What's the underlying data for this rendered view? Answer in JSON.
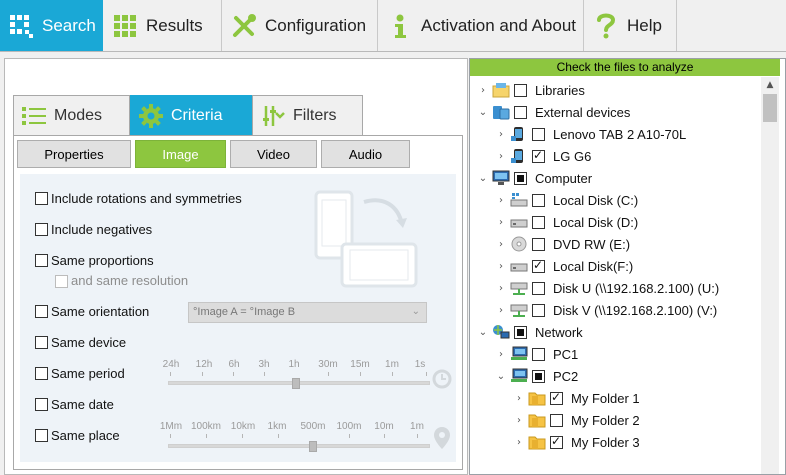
{
  "toolbar": {
    "tabs": [
      {
        "label": "Search",
        "icon": "magnifier-grid-icon",
        "active": true
      },
      {
        "label": "Results",
        "icon": "grid-icon",
        "active": false
      },
      {
        "label": "Configuration",
        "icon": "wrench-screwdriver-icon",
        "active": false
      },
      {
        "label": "Activation and About",
        "icon": "info-icon",
        "active": false
      },
      {
        "label": "Help",
        "icon": "question-icon",
        "active": false
      }
    ]
  },
  "left": {
    "subtabs": [
      {
        "label": "Modes",
        "icon": "list-icon"
      },
      {
        "label": "Criteria",
        "icon": "gear-icon"
      },
      {
        "label": "Filters",
        "icon": "filter-icon"
      }
    ],
    "buttons": [
      "Properties",
      "Image",
      "Video",
      "Audio"
    ],
    "options": {
      "rotations": "Include rotations and symmetries",
      "negatives": "Include negatives",
      "proportions": "Same proportions",
      "resolution": "and same resolution",
      "orientation": "Same orientation",
      "orientation_value": "°Image A  = °Image B",
      "device": "Same device",
      "period": "Same period",
      "date": "Same date",
      "place": "Same place"
    },
    "period_ticks": [
      "24h",
      "12h",
      "6h",
      "3h",
      "1h",
      "30m",
      "15m",
      "1m",
      "1s"
    ],
    "place_ticks": [
      "1Mm",
      "100km",
      "10km",
      "1km",
      "500m",
      "100m",
      "10m",
      "1m"
    ]
  },
  "tree": {
    "header": "Check the files to analyze",
    "rows": [
      {
        "label": "Libraries",
        "level": 0,
        "arrow": "›",
        "icon": "library-icon",
        "check": "none"
      },
      {
        "label": "External devices",
        "level": 0,
        "arrow": "⌄",
        "icon": "devices-icon",
        "check": "none"
      },
      {
        "label": "Lenovo TAB 2 A10-70L",
        "level": 1,
        "arrow": "›",
        "icon": "mobile-device-icon",
        "check": "none"
      },
      {
        "label": "LG G6",
        "level": 1,
        "arrow": "›",
        "icon": "mobile-device-icon",
        "check": "checked"
      },
      {
        "label": "Computer",
        "level": 0,
        "arrow": "⌄",
        "icon": "computer-icon",
        "check": "partial"
      },
      {
        "label": "Local Disk (C:)",
        "level": 1,
        "arrow": "›",
        "icon": "system-disk-icon",
        "check": "none"
      },
      {
        "label": "Local Disk (D:)",
        "level": 1,
        "arrow": "›",
        "icon": "disk-icon",
        "check": "none"
      },
      {
        "label": "DVD RW (E:)",
        "level": 1,
        "arrow": "›",
        "icon": "dvd-icon",
        "check": "none"
      },
      {
        "label": "Local Disk(F:)",
        "level": 1,
        "arrow": "›",
        "icon": "disk-icon",
        "check": "checked"
      },
      {
        "label": "Disk U  (\\\\192.168.2.100) (U:)",
        "level": 1,
        "arrow": "›",
        "icon": "network-drive-icon",
        "check": "none"
      },
      {
        "label": "Disk V  (\\\\192.168.2.100) (V:)",
        "level": 1,
        "arrow": "›",
        "icon": "network-drive-icon",
        "check": "none"
      },
      {
        "label": "Network",
        "level": 0,
        "arrow": "⌄",
        "icon": "network-icon",
        "check": "partial"
      },
      {
        "label": "PC1",
        "level": 1,
        "arrow": "›",
        "icon": "pc-icon",
        "check": "none"
      },
      {
        "label": "PC2",
        "level": 1,
        "arrow": "⌄",
        "icon": "pc-icon",
        "check": "partial"
      },
      {
        "label": "My Folder 1",
        "level": 2,
        "arrow": "›",
        "icon": "folder-icon",
        "check": "checked"
      },
      {
        "label": "My Folder 2",
        "level": 2,
        "arrow": "›",
        "icon": "folder-icon",
        "check": "none"
      },
      {
        "label": "My Folder 3",
        "level": 2,
        "arrow": "›",
        "icon": "folder-icon",
        "check": "checked"
      }
    ]
  },
  "colors": {
    "accent_blue": "#1aa8d6",
    "accent_green": "#8dc63f"
  }
}
